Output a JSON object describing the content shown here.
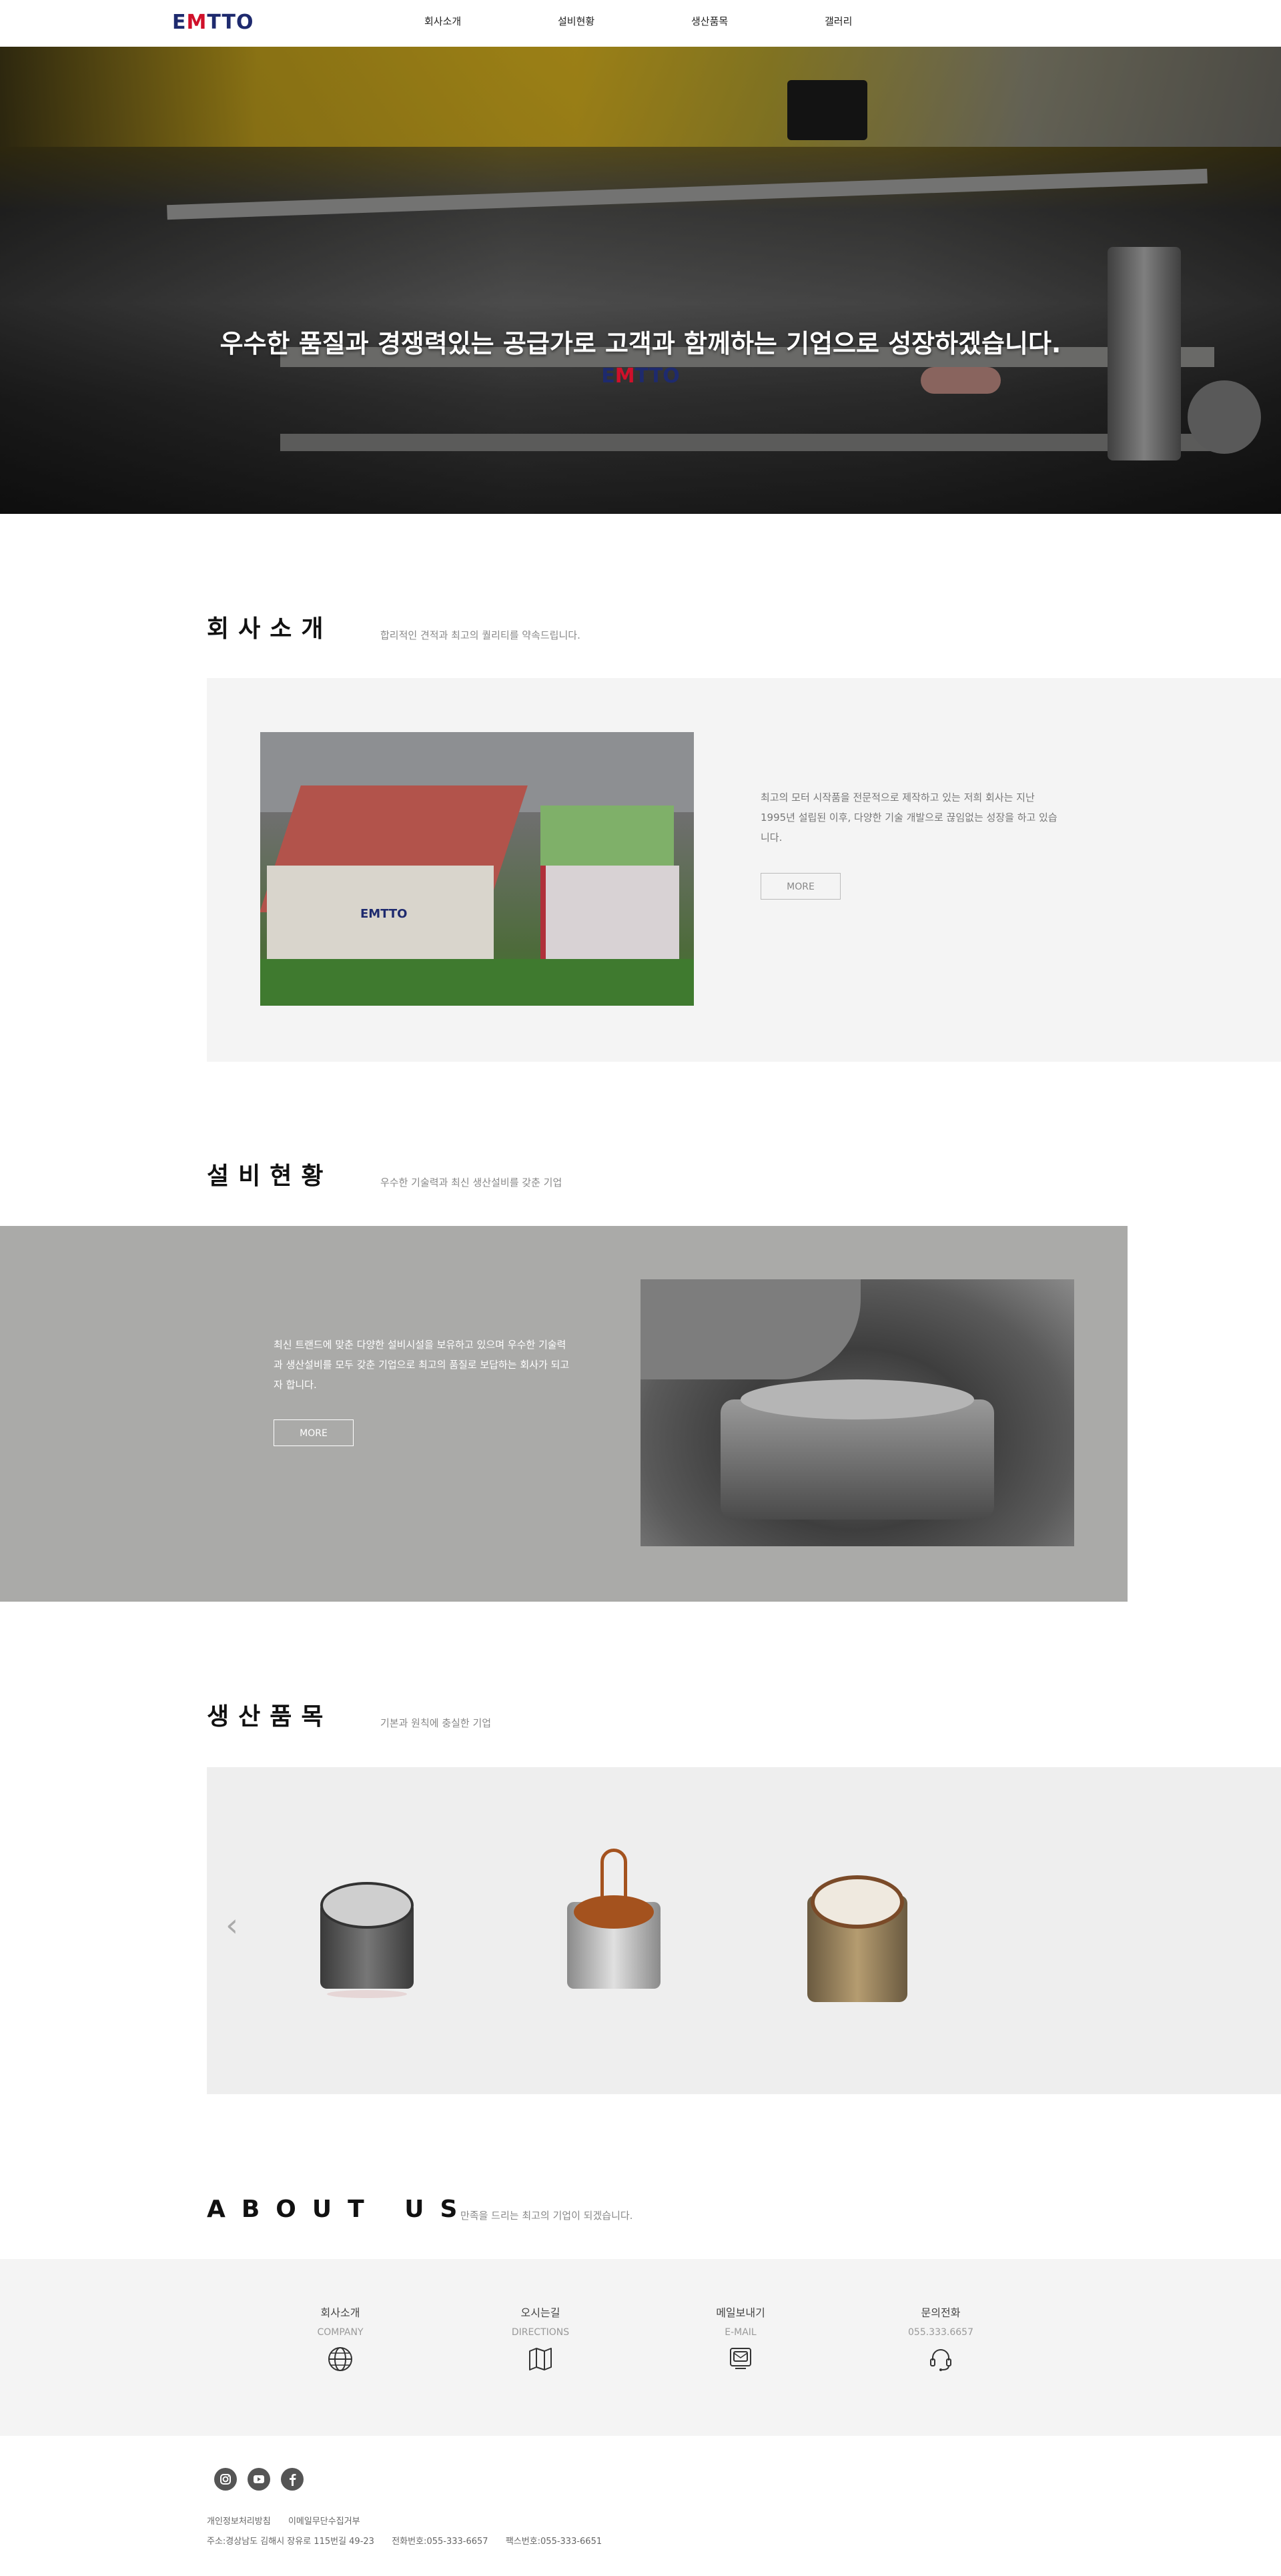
{
  "header": {
    "logo_pre": "E",
    "logo_m": "M",
    "logo_post": "TTO",
    "nav": [
      "회사소개",
      "설비현황",
      "생산품목",
      "갤러리"
    ]
  },
  "hero": {
    "title": "우수한 품질과 경쟁력있는 공급가로 고객과 함께하는 기업으로 성장하겠습니다.",
    "logo_pre": "E",
    "logo_m": "M",
    "logo_post": "TTO"
  },
  "company": {
    "title": "회사소개",
    "subtitle": "합리적인 견적과 최고의 퀄리티를 약속드립니다.",
    "text": "최고의 모터 시작품을 전문적으로 제작하고 있는 저희 회사는 지난 1995년 설립된 이후, 다양한 기술 개발으로 끊임없는 성장을 하고 있습니다.",
    "more": "MORE",
    "sign": "EMTTO"
  },
  "equipment": {
    "title": "설비현황",
    "subtitle": "우수한 기술력과 최신 생산설비를 갖춘 기업",
    "text": "최신 트랜드에 맞춘 다양한 설비시설을 보유하고 있으며 우수한 기술력과 생산설비를 모두 갖춘 기업으로 최고의 품질로 보답하는 회사가 되고자 합니다.",
    "more": "MORE"
  },
  "products": {
    "title": "생산품목",
    "subtitle": "기본과 원칙에 충실한 기업",
    "prev_arrow": "‹"
  },
  "about": {
    "title": "ABOUT US",
    "subtitle": "만족을 드리는 최고의 기업이 되겠습니다.",
    "items": [
      {
        "title": "회사소개",
        "sub": "COMPANY",
        "icon": "globe-icon"
      },
      {
        "title": "오시는길",
        "sub": "DIRECTIONS",
        "icon": "map-icon"
      },
      {
        "title": "메일보내기",
        "sub": "E-MAIL",
        "icon": "mail-icon"
      },
      {
        "title": "문의전화",
        "sub": "055.333.6657",
        "icon": "headset-icon"
      }
    ]
  },
  "footer": {
    "social": [
      "instagram-icon",
      "youtube-icon",
      "facebook-icon"
    ],
    "links": [
      "개인정보처리방침",
      "이메일무단수집거부"
    ],
    "address": "주소:경상남도 김해시 장유로 115번길 49-23",
    "phone": "전화번호:055-333-6657",
    "fax": "팩스번호:055-333-6651"
  },
  "colors": {
    "brand_navy": "#1e2a6e",
    "brand_red": "#d0102a",
    "panel_light": "#f4f4f4",
    "panel_gray": "#aaaaa8"
  }
}
